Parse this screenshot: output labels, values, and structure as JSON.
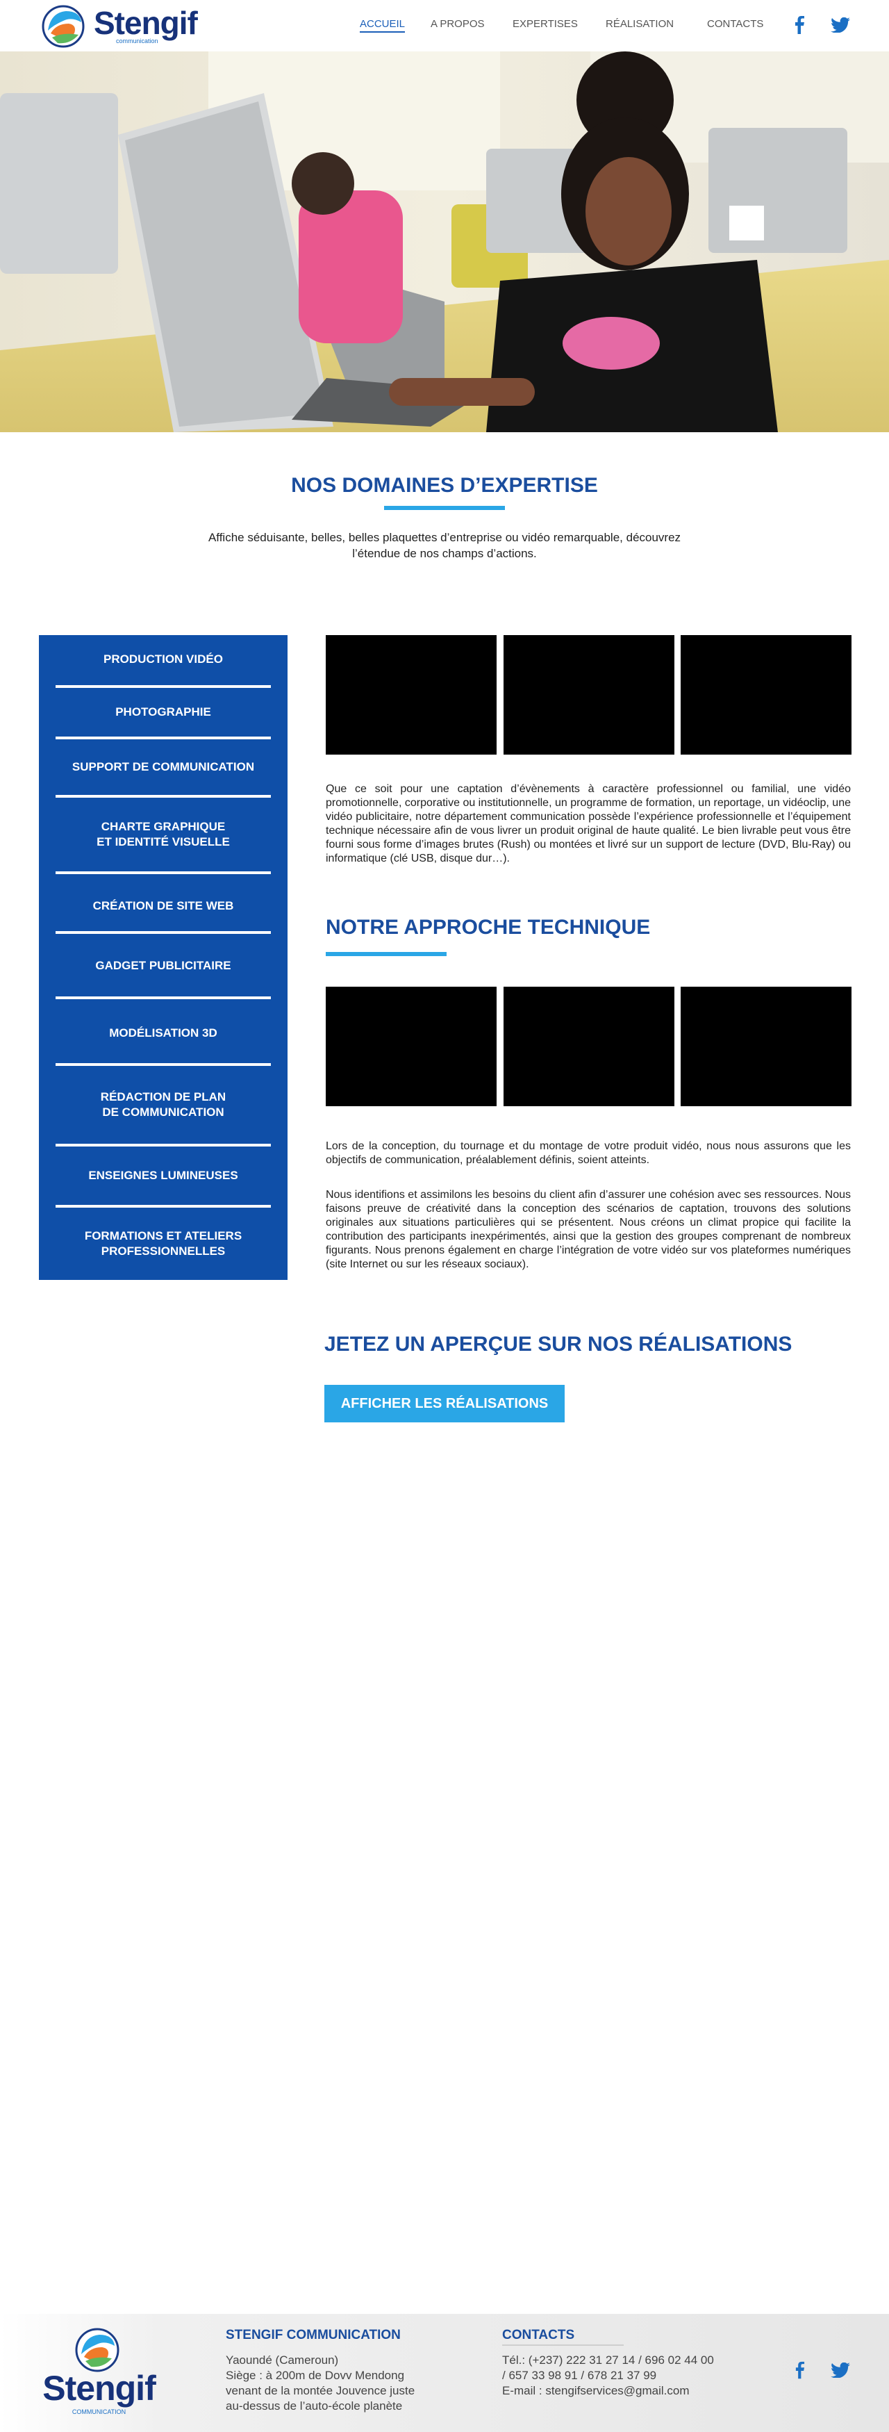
{
  "brand": {
    "name": "Stengif",
    "tagline": "communication"
  },
  "nav": {
    "items": [
      "ACCUEIL",
      "A PROPOS",
      "EXPERTISES",
      "RÉALISATION",
      "CONTACTS"
    ],
    "active": "ACCUEIL"
  },
  "social": {
    "facebook_icon": "facebook-icon",
    "twitter_icon": "twitter-icon"
  },
  "expertise": {
    "title": "NOS DOMAINES D’EXPERTISE",
    "description": "Affiche séduisante, belles, belles plaquettes d’entreprise ou vidéo remarquable, découvrez l’étendue de nos champs d’actions."
  },
  "sidebar": {
    "items": [
      {
        "line1": "PRODUCTION VIDÉO",
        "line2": ""
      },
      {
        "line1": "PHOTOGRAPHIE",
        "line2": ""
      },
      {
        "line1": "SUPPORT DE COMMUNICATION",
        "line2": ""
      },
      {
        "line1": "CHARTE GRAPHIQUE",
        "line2": "ET IDENTITÉ VISUELLE"
      },
      {
        "line1": "CRÉATION DE SITE WEB",
        "line2": ""
      },
      {
        "line1": "GADGET PUBLICITAIRE",
        "line2": ""
      },
      {
        "line1": "MODÉLISATION 3D",
        "line2": ""
      },
      {
        "line1": "RÉDACTION DE PLAN",
        "line2": "DE COMMUNICATION"
      },
      {
        "line1": "ENSEIGNES LUMINEUSES",
        "line2": ""
      },
      {
        "line1": "FORMATIONS ET ATELIERS",
        "line2": "PROFESSIONNELLES"
      }
    ]
  },
  "main": {
    "intro": "Que ce soit pour une captation d’évènements à caractère professionnel ou familial, une vidéo promotionnelle, corporative ou institutionnelle, un programme de formation, un reportage, un vidéoclip, une vidéo publicitaire, notre département communication possède l’expérience professionnelle et l’équipement technique nécessaire afin de vous livrer un produit original de haute qualité. Le bien livrable peut vous être fourni sous forme d’images brutes (Rush) ou montées et livré sur un support de lecture (DVD, Blu-Ray) ou informatique (clé USB, disque dur…).",
    "approach_title": "NOTRE APPROCHE TECHNIQUE",
    "approach_p1": "Lors de la conception, du tournage et du montage de votre produit vidéo, nous nous assurons que les objectifs de communication, préalablement définis, soient atteints.",
    "approach_p2": "Nous identifions et assimilons les besoins du client afin d’assurer une cohésion avec ses ressources. Nous faisons preuve de créativité dans la conception des scénarios de captation, trouvons des solutions originales aux situations particulières qui se présentent. Nous créons un climat propice qui facilite la contribution des participants inexpérimentés, ainsi que la gestion des groupes comprenant de nombreux figurants. Nous prenons également en charge l’intégration de votre vidéo sur vos plateformes numériques (site Internet ou sur les réseaux sociaux).",
    "realisations_title": "JETEZ UN APERÇUE SUR NOS RÉALISATIONS",
    "cta_label": "AFFICHER LES RÉALISATIONS"
  },
  "footer": {
    "brand": "Stengif",
    "brand_sub": "COMMUNICATION",
    "company_title": "STENGIF COMMUNICATION",
    "address": [
      "Yaoundé (Cameroun)",
      "Siège : à 200m de Dovv Mendong",
      "venant de la montée Jouvence juste",
      "au-dessus de l’auto-école planète"
    ],
    "contacts_title": "CONTACTS",
    "contacts": [
      "Tél.: (+237) 222 31 27 14 / 696 02 44 00",
      "/ 657 33 98 91 / 678 21 37 99",
      "E-mail : stengifservices@gmail.com"
    ]
  },
  "colors": {
    "primary": "#0f4fa8",
    "heading": "#1a4d9e",
    "accent": "#2aa6e6"
  }
}
